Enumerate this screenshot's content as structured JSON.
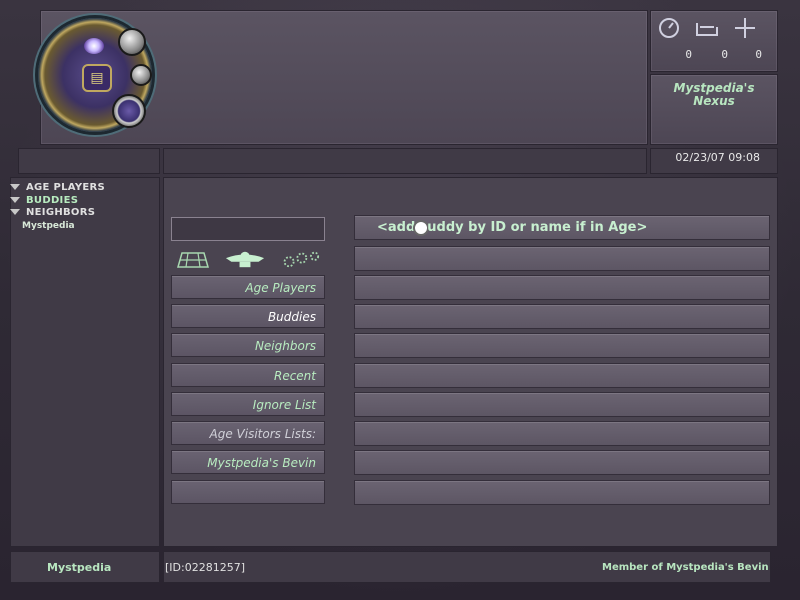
{
  "nexus": {
    "title": "Mystpedia's Nexus",
    "counts": [
      "0",
      "0",
      "0"
    ],
    "status_icons": [
      "compass-icon",
      "ladder-icon",
      "transfer-icon"
    ],
    "datetime": "02/23/07  09:08"
  },
  "tree": {
    "groups": [
      "AGE PLAYERS",
      "BUDDIES",
      "NEIGHBORS"
    ],
    "sub_item": "Mystpedia"
  },
  "categories": [
    {
      "label": "Age Players",
      "active": false
    },
    {
      "label": "Buddies",
      "active": true
    },
    {
      "label": "Neighbors",
      "active": false
    },
    {
      "label": "Recent",
      "active": false
    },
    {
      "label": "Ignore List",
      "active": false
    },
    {
      "label": "Age Visitors Lists:",
      "active": false
    },
    {
      "label": "Mystpedia's Bevin",
      "active": false
    },
    {
      "label": "",
      "active": false
    }
  ],
  "filter_icons": [
    "grid-icon",
    "buddy-group-icon",
    "gear-chain-icon"
  ],
  "list": {
    "add_prompt_before": "<add",
    "add_prompt_after": "uddy by ID or name if in Age>"
  },
  "footer": {
    "player_name": "Mystpedia",
    "player_id": "[ID:02281257]",
    "membership": "Member of Mystpedia's Bevin"
  },
  "colors": {
    "label_green": "#b8ecc0",
    "panel": "#5b5462",
    "background": "#2a2530"
  }
}
